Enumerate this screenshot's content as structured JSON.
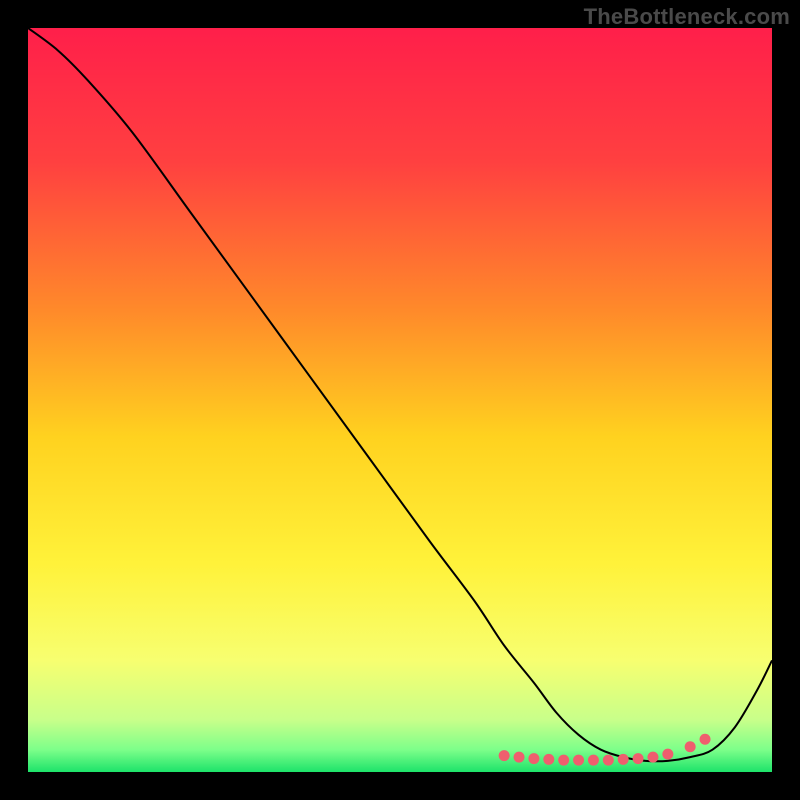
{
  "watermark": "TheBottleneck.com",
  "chart_data": {
    "type": "line",
    "title": "",
    "xlabel": "",
    "ylabel": "",
    "xlim": [
      0,
      100
    ],
    "ylim": [
      0,
      100
    ],
    "background_gradient_stops": [
      {
        "offset": 0,
        "color": "#ff1f4a"
      },
      {
        "offset": 0.18,
        "color": "#ff4040"
      },
      {
        "offset": 0.38,
        "color": "#ff8a2a"
      },
      {
        "offset": 0.55,
        "color": "#ffd21f"
      },
      {
        "offset": 0.72,
        "color": "#fff23a"
      },
      {
        "offset": 0.85,
        "color": "#f7ff70"
      },
      {
        "offset": 0.93,
        "color": "#c8ff8a"
      },
      {
        "offset": 0.97,
        "color": "#7dff8a"
      },
      {
        "offset": 1.0,
        "color": "#1de36a"
      }
    ],
    "series": [
      {
        "name": "curve",
        "stroke": "#000000",
        "x": [
          0,
          4,
          8,
          14,
          22,
          30,
          38,
          46,
          54,
          60,
          64,
          68,
          71,
          74,
          77,
          80,
          83,
          86,
          89,
          92,
          95,
          98,
          100
        ],
        "y": [
          100,
          97,
          93,
          86,
          75,
          64,
          53,
          42,
          31,
          23,
          17,
          12,
          8,
          5,
          3,
          2,
          1.5,
          1.5,
          2,
          3,
          6,
          11,
          15
        ]
      }
    ],
    "markers": {
      "name": "balanced-region",
      "color": "#ef5e6e",
      "radius": 5.5,
      "x": [
        64,
        66,
        68,
        70,
        72,
        74,
        76,
        78,
        80,
        82,
        84,
        86,
        89,
        91
      ],
      "y": [
        2.2,
        2.0,
        1.8,
        1.7,
        1.6,
        1.6,
        1.6,
        1.6,
        1.7,
        1.8,
        2.0,
        2.4,
        3.4,
        4.4
      ]
    }
  }
}
